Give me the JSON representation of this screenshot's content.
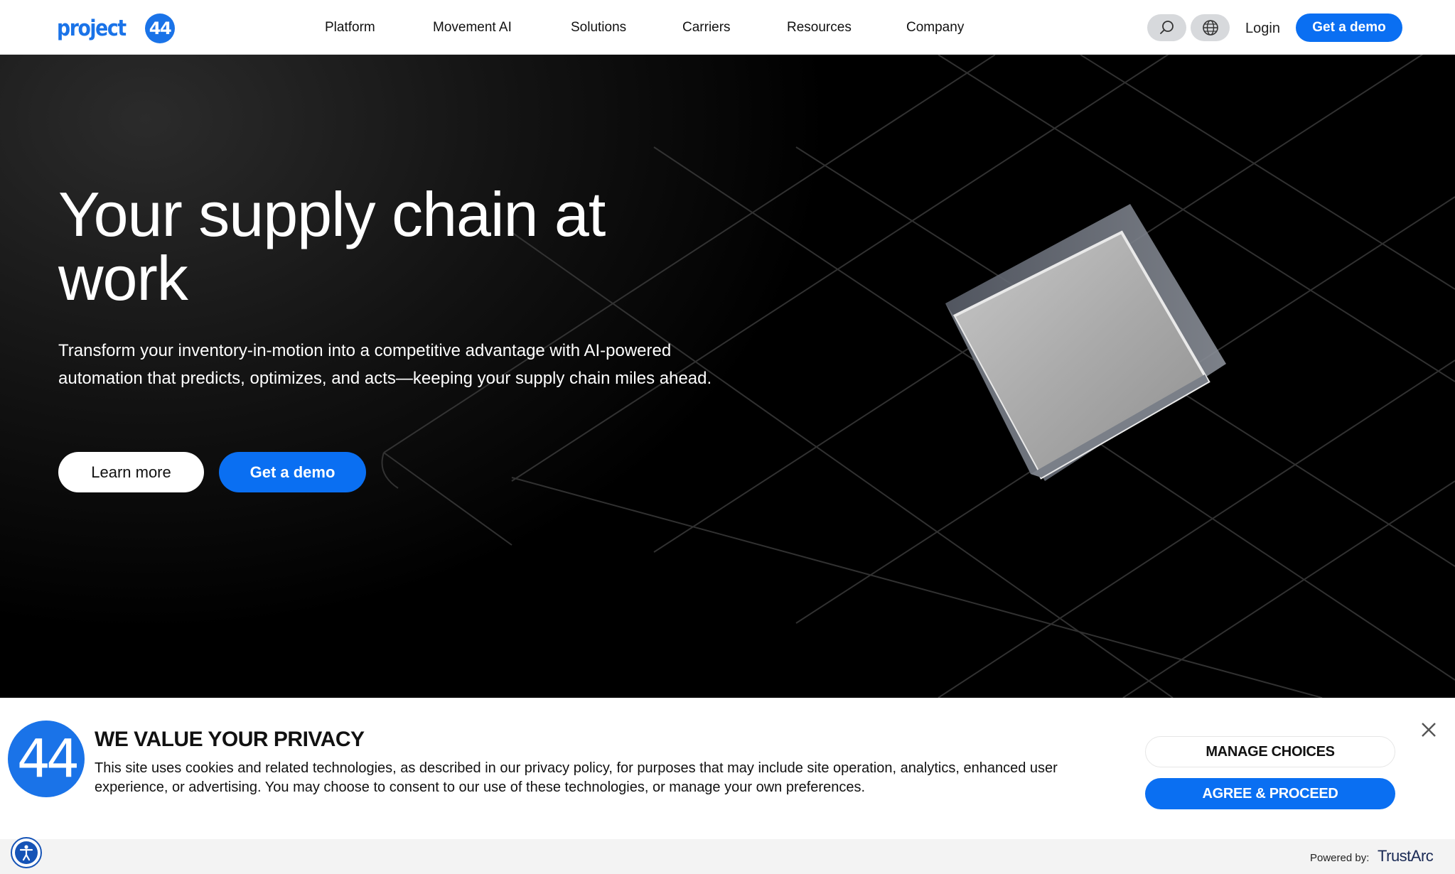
{
  "header": {
    "logo_text": "project",
    "logo_badge": "44",
    "nav": [
      "Platform",
      "Movement AI",
      "Solutions",
      "Carriers",
      "Resources",
      "Company"
    ],
    "search_icon": "search-icon",
    "globe_icon": "globe-icon",
    "login_label": "Login",
    "demo_label": "Get a demo"
  },
  "hero": {
    "title": "Your supply chain at work",
    "subtitle": "Transform your inventory-in-motion into a competitive advantage with AI-powered automation that predicts, optimizes, and acts—keeping your supply chain miles ahead.",
    "learn_more_label": "Learn more",
    "demo_label": "Get a demo"
  },
  "cookie_banner": {
    "logo_text": "44",
    "title": "WE VALUE YOUR PRIVACY",
    "body": "This site uses cookies and related technologies, as described in our privacy policy, for purposes that may include site operation, analytics, enhanced user experience, or advertising. You may choose to consent to our use of these technologies, or manage your own preferences.",
    "manage_label": "MANAGE CHOICES",
    "agree_label": "AGREE & PROCEED",
    "close_icon": "close-icon",
    "powered_by": "Powered by:",
    "provider": "TrustArc",
    "accessibility_icon": "accessibility-icon"
  },
  "colors": {
    "brand_blue": "#0a6ff2",
    "logo_blue": "#1a73e8",
    "hero_bg": "#000000"
  }
}
